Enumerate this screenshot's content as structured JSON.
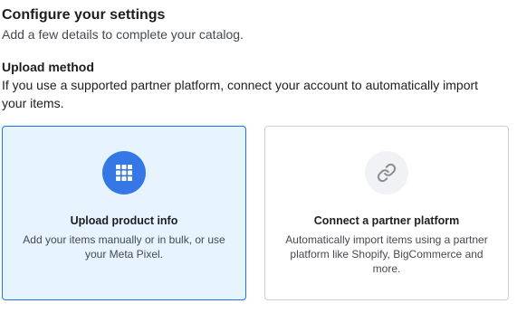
{
  "header": {
    "title": "Configure your settings",
    "subtitle": "Add a few details to complete your catalog."
  },
  "upload_method": {
    "title": "Upload method",
    "description": "If you use a supported partner platform, connect your account to automatically import your items."
  },
  "options": [
    {
      "title": "Upload product info",
      "description": "Add your items manually or in bulk, or use your Meta Pixel.",
      "icon": "grid-icon",
      "selected": true
    },
    {
      "title": "Connect a partner platform",
      "description": "Automatically import items using a partner platform like Shopify, BigCommerce and more.",
      "icon": "link-icon",
      "selected": false
    }
  ],
  "colors": {
    "accent": "#1877f2",
    "selected_bg": "#e7f3ff",
    "icon_blue": "#3578e5",
    "icon_grey_bg": "#f0f2f5"
  }
}
